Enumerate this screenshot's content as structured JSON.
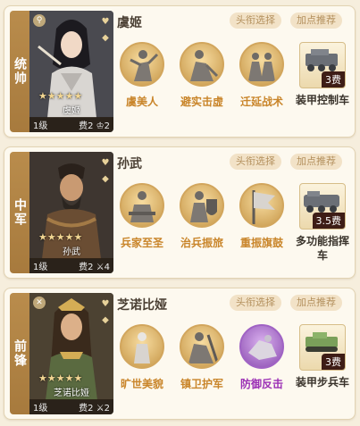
{
  "cards": [
    {
      "role": "统帅",
      "hero": {
        "stars": "★★★★★",
        "name": "虞姬",
        "level": "1级",
        "cost": "费2",
        "extra": "2"
      },
      "general_name": "虞姬",
      "buttons": [
        "头衔选择",
        "加点推荐"
      ],
      "skills": [
        {
          "name": "虞美人",
          "style": "gold",
          "icon": "dancer-icon"
        },
        {
          "name": "避实击虚",
          "style": "gold",
          "icon": "warrior-crouch-icon"
        },
        {
          "name": "迁延战术",
          "style": "gold",
          "icon": "soldiers-icon"
        }
      ],
      "equip": {
        "name": "装甲控制车",
        "cost": "3费",
        "icon": "armored-tank-icon",
        "color": "#6b6f76"
      }
    },
    {
      "role": "中军",
      "hero": {
        "stars": "★★★★★",
        "name": "孙武",
        "level": "1级",
        "cost": "费2",
        "extra": "4"
      },
      "general_name": "孙武",
      "buttons": [
        "头衔选择",
        "加点推荐"
      ],
      "skills": [
        {
          "name": "兵家至圣",
          "style": "gold",
          "icon": "sage-icon"
        },
        {
          "name": "治兵振旅",
          "style": "gold",
          "icon": "knight-shield-icon"
        },
        {
          "name": "重振旗鼓",
          "style": "gold",
          "icon": "banner-icon"
        }
      ],
      "equip": {
        "name": "多功能指挥车",
        "cost": "3.5费",
        "icon": "command-vehicle-icon",
        "color": "#6b6f76"
      }
    },
    {
      "role": "前锋",
      "hero": {
        "stars": "★★★★★",
        "name": "芝诺比娅",
        "level": "1级",
        "cost": "费2",
        "extra": "2"
      },
      "general_name": "芝诺比娅",
      "buttons": [
        "头衔选择",
        "加点推荐"
      ],
      "skills": [
        {
          "name": "旷世美貌",
          "style": "gold",
          "icon": "queen-statue-icon"
        },
        {
          "name": "镇卫护军",
          "style": "gold",
          "icon": "guard-icon"
        },
        {
          "name": "防御反击",
          "style": "purple",
          "icon": "counter-attack-icon"
        }
      ],
      "equip": {
        "name": "装甲步兵车",
        "cost": "3费",
        "icon": "infantry-vehicle-icon",
        "color": "#7aa05a"
      }
    }
  ]
}
